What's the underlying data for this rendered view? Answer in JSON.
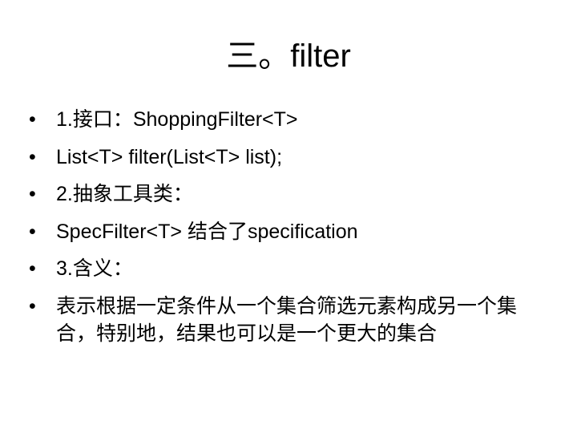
{
  "slide": {
    "title": "三。filter",
    "bullet_symbol": "•",
    "bullets": [
      "1.接口：ShoppingFilter<T>",
      "List<T> filter(List<T> list);",
      "2.抽象工具类：",
      "SpecFilter<T> 结合了specification",
      "3.含义：",
      "表示根据一定条件从一个集合筛选元素构成另一个集合，特别地，结果也可以是一个更大的集合"
    ]
  }
}
